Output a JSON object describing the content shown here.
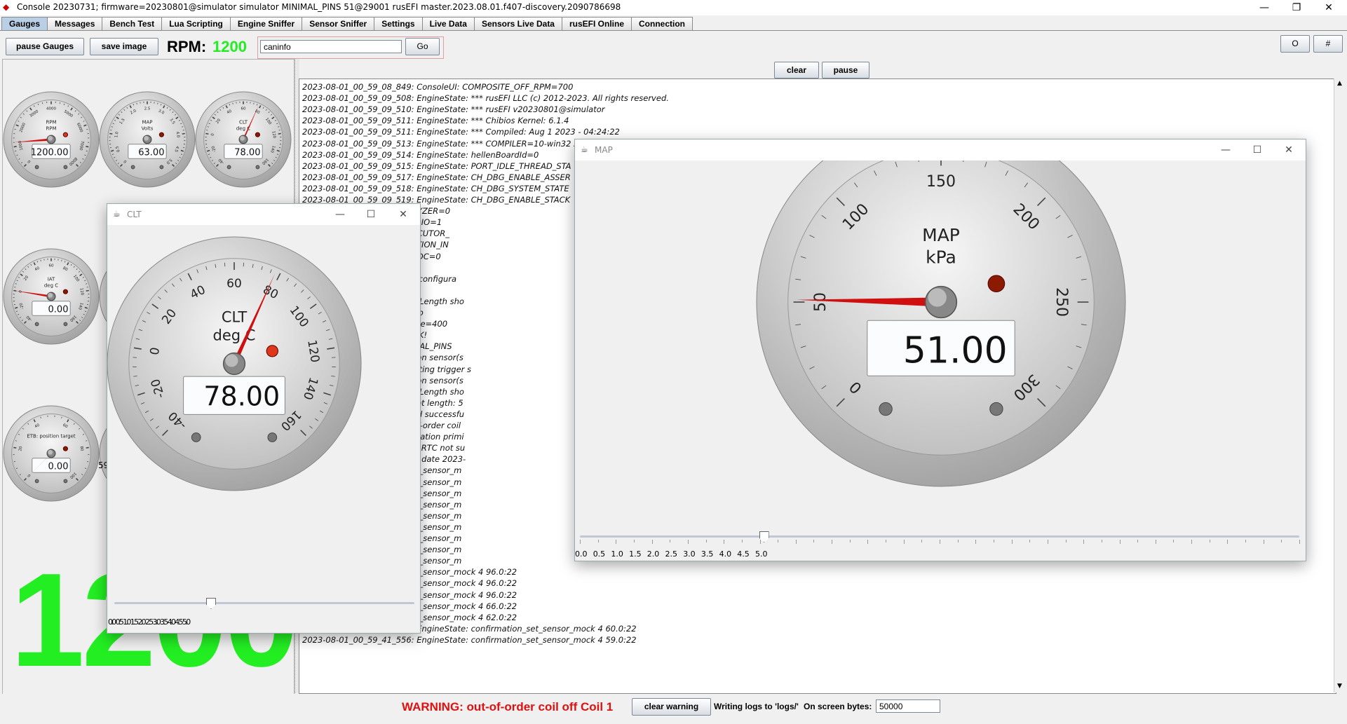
{
  "window": {
    "title": "Console 20230731; firmware=20230801@simulator simulator MINIMAL_PINS 51@29001 rusEFI master.2023.08.01.f407-discovery.2090786698",
    "icon": "rusefi-app-icon"
  },
  "tabs": [
    {
      "label": "Gauges",
      "active": true
    },
    {
      "label": "Messages"
    },
    {
      "label": "Bench Test"
    },
    {
      "label": "Lua Scripting"
    },
    {
      "label": "Engine Sniffer"
    },
    {
      "label": "Sensor Sniffer"
    },
    {
      "label": "Settings"
    },
    {
      "label": "Live Data"
    },
    {
      "label": "Sensors Live Data"
    },
    {
      "label": "rusEFI Online"
    },
    {
      "label": "Connection"
    }
  ],
  "toolbar": {
    "pause_label": "pause Gauges",
    "save_label": "save image",
    "rpm_label": "RPM:",
    "rpm_value": "1200",
    "command_value": "caninfo",
    "go_label": "Go",
    "o_label": "O",
    "hash_label": "#"
  },
  "log_controls": {
    "clear_label": "clear",
    "pause_label": "pause"
  },
  "mini_gauges": [
    {
      "name": "RPM",
      "unit": "RPM",
      "value": "1200.00",
      "ticks": [
        "0",
        "1000",
        "2000",
        "3000",
        "4000",
        "5000",
        "6000",
        "7000",
        "8000"
      ]
    },
    {
      "name": "MAP",
      "unit": "Volts",
      "value": "63.00",
      "ticks": [
        "0",
        "0.5",
        "1.0",
        "1.5",
        "2.0",
        "2.5",
        "3.0",
        "3.5",
        "4.0",
        "4.5",
        "5.0"
      ]
    },
    {
      "name": "CLT",
      "unit": "deg C",
      "value": "78.00",
      "ticks": [
        "-40",
        "-20",
        "0",
        "20",
        "40",
        "60",
        "80",
        "100",
        "120",
        "140",
        "160"
      ]
    },
    {
      "name": "IAT",
      "unit": "deg C",
      "value": "0.00",
      "ticks": [
        "-40",
        "-20",
        "0",
        "20",
        "40",
        "60",
        "80",
        "100",
        "120",
        "140",
        "160"
      ]
    },
    {
      "name": "ETB: position target",
      "unit": "",
      "value": "0.00",
      "ticks": [
        "0",
        "20",
        "40",
        "60",
        "80",
        "100"
      ]
    }
  ],
  "rpm_big": "1200",
  "clipped_gauge_label": "59",
  "log_lines": [
    "2023-08-01_00_59_08_849: ConsoleUI: COMPOSITE_OFF_RPM=700",
    "2023-08-01_00_59_09_508: EngineState: *** rusEFI LLC (c) 2012-2023. All rights reserved.",
    "2023-08-01_00_59_09_510: EngineState: *** rusEFI v20230801@simulator",
    "2023-08-01_00_59_09_511: EngineState: *** Chibios Kernel:       6.1.4",
    "2023-08-01_00_59_09_511: EngineState: *** Compiled:     Aug  1 2023 - 04:24:22",
    "2023-08-01_00_59_09_513: EngineState: *** COMPILER=10-win32 20",
    "2023-08-01_00_59_09_514: EngineState: hellenBoardId=0",
    "2023-08-01_00_59_09_515: EngineState: PORT_IDLE_THREAD_STA",
    "2023-08-01_00_59_09_517: EngineState: CH_DBG_ENABLE_ASSER",
    "2023-08-01_00_59_09_518: EngineState: CH_DBG_SYSTEM_STATE",
    "2023-08-01_00_59_09_519: EngineState: CH_DBG_ENABLE_STACK",
    "ngineState: EFI_LOGIC_ANALYZER=0",
    "ngineState: EFI_TUNER_STUDIO=1",
    "ngineState: EFI_SIGNAL_EXECUTOR_",
    "ngineState: EFI_SHAFT_POSITION_IN",
    "ngineState: EFI_INTERNAL_ADC=0",
    "ngineState: readFromFlash 1",
    "ngineState: Reading second configura",
    "ngineState: readFromFlash 2",
    "ngineState: setTpsAccelLen: Length sho",
    "ngineState: engine sniffer: No",
    "ngineState: engine sniffer size=400",
    "ngineState: initHardware() OK!",
    "ngineState: Emulating MINIMAL_PINS",
    "ngineState: Emulating position sensor(s",
    "ngineState: Stimulator: updating trigger s",
    "ngineState: Emulating position sensor(s",
    "ngineState: setTpsAccelLen: Length sho",
    "ngineState: LUA loading script length: 5",
    "ngineState: LUA script loaded successfu",
    "ngineState: WARNING: out-of-order coil",
    "ngineState: Skipped zero-duration primi",
    "ngineState: Cannot set time: RTC not su",
    "ngineState: confirmation_set date 2023-",
    "ngineState: confirmation_set_sensor_m",
    "ngineState: confirmation_set_sensor_m",
    "ngineState: confirmation_set_sensor_m",
    "ngineState: confirmation_set_sensor_m",
    "ngineState: confirmation_set_sensor_m",
    "ngineState: confirmation_set_sensor_m",
    "ngineState: confirmation_set_sensor_m",
    "ngineState: confirmation_set_sensor_m",
    "ngineState: confirmation_set_sensor_m",
    "ngineState: confirmation_set_sensor_mock 4 96.0:22",
    "ngineState: confirmation_set_sensor_mock 4 96.0:22",
    "ngineState: confirmation_set_sensor_mock 4 96.0:22",
    "ngineState: confirmation_set_sensor_mock 4 66.0:22",
    "ngineState: confirmation_set_sensor_mock 4 62.0:22",
    "2023-08-01_00_59_41_555: EngineState: confirmation_set_sensor_mock 4 60.0:22",
    "2023-08-01_00_59_41_556: EngineState: confirmation_set_sensor_mock 4 59.0:22"
  ],
  "clt_window": {
    "title": "CLT",
    "name": "CLT",
    "unit": "deg C",
    "value": "78.00",
    "ticks": [
      "-40",
      "-20",
      "0",
      "20",
      "40",
      "60",
      "80",
      "100",
      "120",
      "140",
      "160"
    ],
    "slider_ticks": "0.0 0.5 1.0 1.5 2.0 2.5 3.0 3.5 4.0 4.5 5.0",
    "slider_position": 0.32
  },
  "map_window": {
    "title": "MAP",
    "name": "MAP",
    "unit": "kPa",
    "value": "51.00",
    "ticks": [
      "0",
      "50",
      "100",
      "150",
      "200",
      "250",
      "300"
    ],
    "slider_ticks": [
      "0.0",
      "0.5",
      "1.0",
      "1.5",
      "2.0",
      "2.5",
      "3.0",
      "3.5",
      "4.0",
      "4.5",
      "5.0"
    ],
    "slider_position": 0.255
  },
  "status": {
    "warning": "WARNING: out-of-order coil off Coil 1",
    "clear_warning_label": "clear warning",
    "writing_logs": "Writing logs to 'logs/'",
    "bytes_label": "On screen bytes:",
    "bytes_value": "50000"
  },
  "colors": {
    "rpm_green": "#22ee22",
    "warning_red": "#e01010",
    "needle_red": "#d01010",
    "tab_active": "#b8cfe5"
  }
}
